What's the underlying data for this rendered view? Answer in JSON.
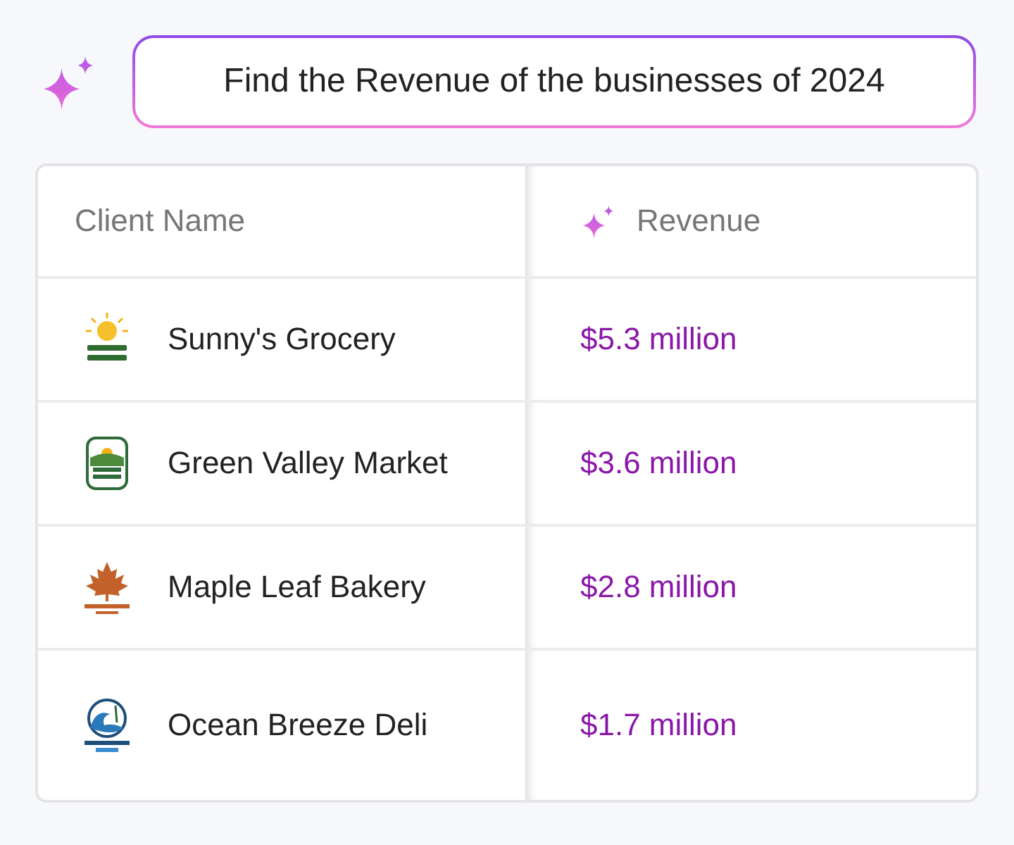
{
  "prompt": {
    "value": "Find the Revenue of the businesses of 2024"
  },
  "table": {
    "columns": [
      "Client Name",
      "Revenue"
    ],
    "rows": [
      {
        "client": "Sunny's Grocery",
        "revenue": "$5.3 million"
      },
      {
        "client": "Green Valley Market",
        "revenue": "$3.6 million"
      },
      {
        "client": "Maple Leaf Bakery",
        "revenue": "$2.8 million"
      },
      {
        "client": "Ocean Breeze Deli",
        "revenue": "$1.7 million"
      }
    ]
  }
}
